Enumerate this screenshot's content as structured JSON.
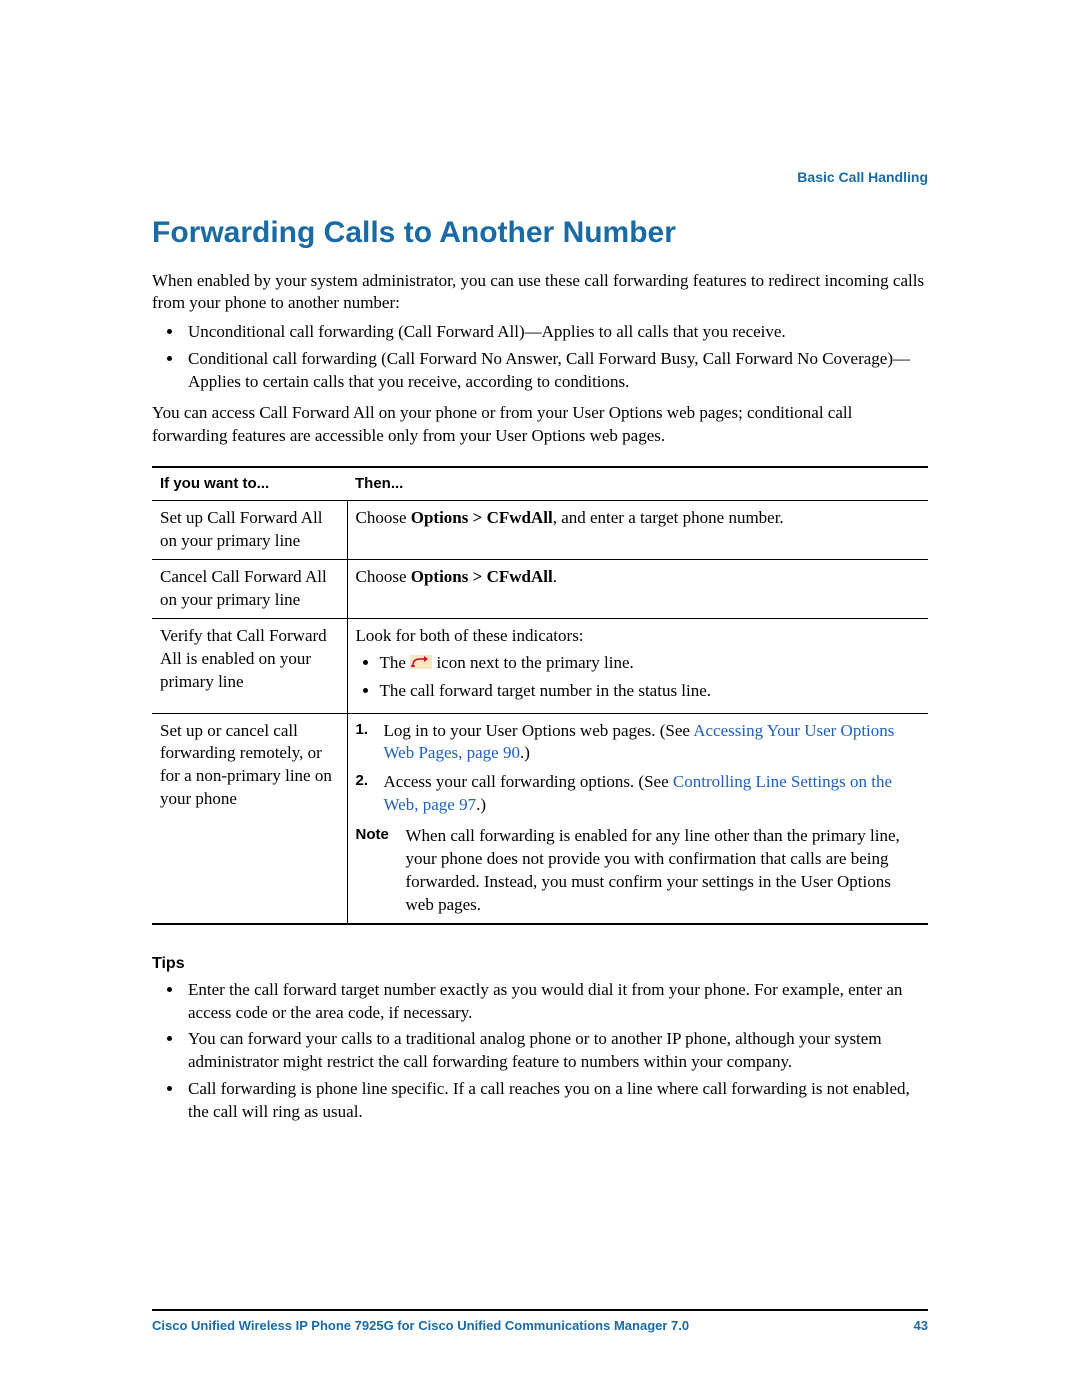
{
  "section": "Basic Call Handling",
  "heading": "Forwarding Calls to Another Number",
  "intro": "When enabled by your system administrator, you can use these call forwarding features to redirect incoming calls from your phone to another number:",
  "intro_bullets": [
    "Unconditional call forwarding (Call Forward All)—Applies to all calls that you receive.",
    "Conditional call forwarding (Call Forward No Answer, Call Forward Busy, Call Forward No Coverage)—Applies to certain calls that you receive, according to conditions."
  ],
  "intro_after": "You can access Call Forward All on your phone or from your User Options web pages; conditional call forwarding features are accessible only from your User Options web pages.",
  "table": {
    "headers": {
      "col1": "If you want to...",
      "col2": "Then..."
    },
    "rows": [
      {
        "left": "Set up Call Forward All on your primary line",
        "right_pre": "Choose ",
        "right_bold": "Options > CFwdAll",
        "right_post": ", and enter a target phone number."
      },
      {
        "left": "Cancel Call Forward All on your primary line",
        "right_pre": "Choose ",
        "right_bold": "Options > CFwdAll",
        "right_post": "."
      },
      {
        "left": "Verify that Call Forward All is enabled on your primary line",
        "right_lead": "Look for both of these indicators:",
        "bullets": {
          "b1_pre": "The ",
          "b1_post": " icon next to the primary line.",
          "b2": "The call forward target number in the status line."
        }
      },
      {
        "left": "Set up or cancel call forwarding remotely, or for a non-primary line on your phone",
        "steps": {
          "s1_pre": "Log in to your User Options web pages. (See ",
          "s1_link": "Accessing Your User Options Web Pages, page 90",
          "s1_post": ".)",
          "s2_pre": "Access your call forwarding options. (See ",
          "s2_link": "Controlling Line Settings on the Web, page 97",
          "s2_post": ".)"
        },
        "note_label": "Note",
        "note_text": "When call forwarding is enabled for any line other than the primary line, your phone does not provide you with confirmation that calls are being forwarded. Instead, you must confirm your settings in the User Options web pages."
      }
    ],
    "step_num1": "1.",
    "step_num2": "2."
  },
  "tips_heading": "Tips",
  "tips": [
    "Enter the call forward target number exactly as you would dial it from your phone. For example, enter an access code or the area code, if necessary.",
    "You can forward your calls to a traditional analog phone or to another IP phone, although your system administrator might restrict the call forwarding feature to numbers within your company.",
    "Call forwarding is phone line specific. If a call reaches you on a line where call forwarding is not enabled, the call will ring as usual."
  ],
  "footer": {
    "title": "Cisco Unified Wireless IP Phone 7925G for Cisco Unified Communications Manager 7.0",
    "page": "43"
  }
}
